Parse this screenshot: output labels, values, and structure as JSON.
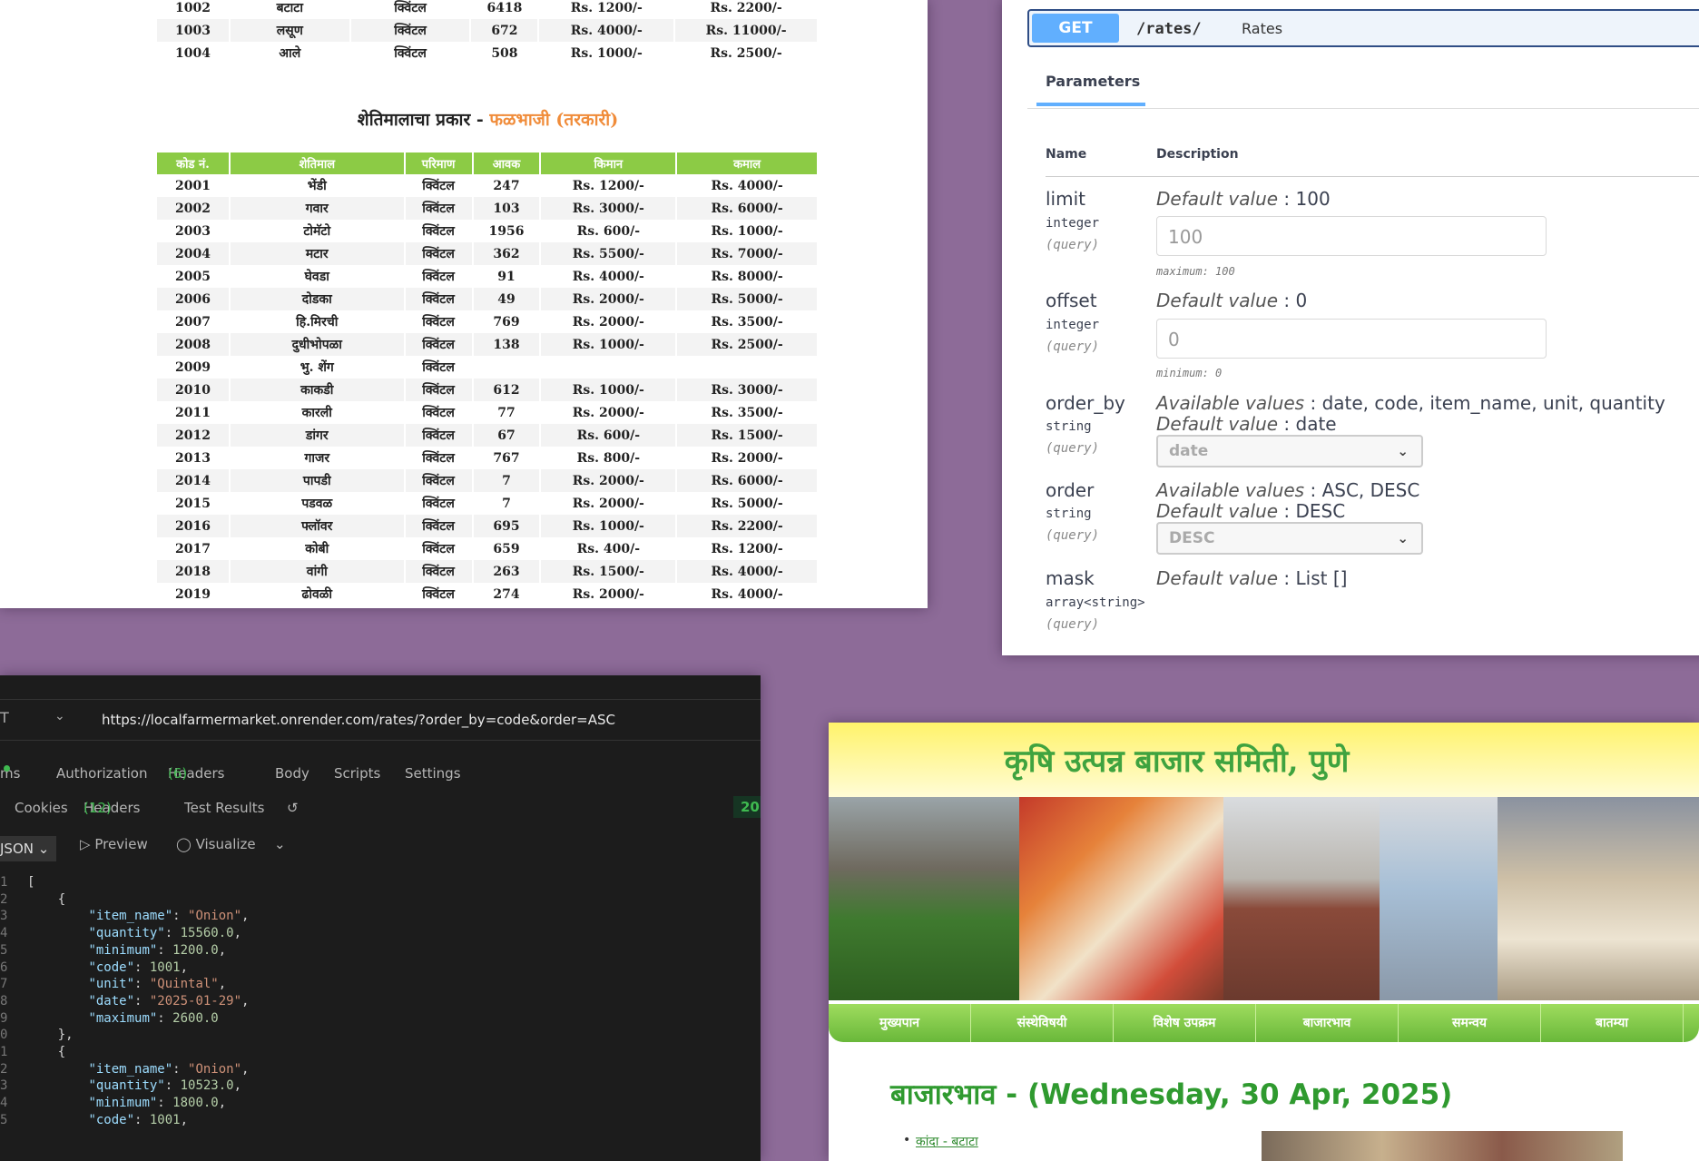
{
  "rates_sheet": {
    "top_rows": [
      [
        "1002",
        "बटाटा",
        "क्विंटल",
        "6418",
        "Rs. 1200/-",
        "Rs. 2200/-"
      ],
      [
        "1003",
        "लसूण",
        "क्विंटल",
        "672",
        "Rs. 4000/-",
        "Rs. 11000/-"
      ],
      [
        "1004",
        "आले",
        "क्विंटल",
        "508",
        "Rs. 1000/-",
        "Rs. 2500/-"
      ]
    ],
    "category_heading": "शेतिमालाचा प्रकार -",
    "category_name": "फळभाजी (तरकारी)",
    "columns": [
      "कोड नं.",
      "शेतिमाल",
      "परिमाण",
      "आवक",
      "किमान",
      "कमाल"
    ],
    "rows": [
      [
        "2001",
        "भेंडी",
        "क्विंटल",
        "247",
        "Rs. 1200/-",
        "Rs. 4000/-"
      ],
      [
        "2002",
        "गवार",
        "क्विंटल",
        "103",
        "Rs. 3000/-",
        "Rs. 6000/-"
      ],
      [
        "2003",
        "टोमॅटो",
        "क्विंटल",
        "1956",
        "Rs. 600/-",
        "Rs. 1000/-"
      ],
      [
        "2004",
        "मटार",
        "क्विंटल",
        "362",
        "Rs. 5500/-",
        "Rs. 7000/-"
      ],
      [
        "2005",
        "घेवडा",
        "क्विंटल",
        "91",
        "Rs. 4000/-",
        "Rs. 8000/-"
      ],
      [
        "2006",
        "दोडका",
        "क्विंटल",
        "49",
        "Rs. 2000/-",
        "Rs. 5000/-"
      ],
      [
        "2007",
        "हि.मिरची",
        "क्विंटल",
        "769",
        "Rs. 2000/-",
        "Rs. 3500/-"
      ],
      [
        "2008",
        "दुधीभोपळा",
        "क्विंटल",
        "138",
        "Rs. 1000/-",
        "Rs. 2500/-"
      ],
      [
        "2009",
        "भु. शेंग",
        "क्विंटल",
        "",
        "",
        ""
      ],
      [
        "2010",
        "काकडी",
        "क्विंटल",
        "612",
        "Rs. 1000/-",
        "Rs. 3000/-"
      ],
      [
        "2011",
        "कारली",
        "क्विंटल",
        "77",
        "Rs. 2000/-",
        "Rs. 3500/-"
      ],
      [
        "2012",
        "डांगर",
        "क्विंटल",
        "67",
        "Rs. 600/-",
        "Rs. 1500/-"
      ],
      [
        "2013",
        "गाजर",
        "क्विंटल",
        "767",
        "Rs. 800/-",
        "Rs. 2000/-"
      ],
      [
        "2014",
        "पापडी",
        "क्विंटल",
        "7",
        "Rs. 2000/-",
        "Rs. 6000/-"
      ],
      [
        "2015",
        "पडवळ",
        "क्विंटल",
        "7",
        "Rs. 2000/-",
        "Rs. 5000/-"
      ],
      [
        "2016",
        "फ्लॉवर",
        "क्विंटल",
        "695",
        "Rs. 1000/-",
        "Rs. 2200/-"
      ],
      [
        "2017",
        "कोबी",
        "क्विंटल",
        "659",
        "Rs. 400/-",
        "Rs. 1200/-"
      ],
      [
        "2018",
        "वांगी",
        "क्विंटल",
        "263",
        "Rs. 1500/-",
        "Rs. 4000/-"
      ],
      [
        "2019",
        "ढोवळी",
        "क्विंटल",
        "274",
        "Rs. 2000/-",
        "Rs. 4000/-"
      ]
    ]
  },
  "swagger": {
    "method": "GET",
    "path": "/rates/",
    "summary": "Rates",
    "tab": "Parameters",
    "col_name": "Name",
    "col_description": "Description",
    "params": {
      "limit": {
        "name": "limit",
        "type": "integer",
        "in": "(query)",
        "default_label": "Default value",
        "default": "100",
        "input": "100",
        "note": "maximum: 100"
      },
      "offset": {
        "name": "offset",
        "type": "integer",
        "in": "(query)",
        "default_label": "Default value",
        "default": "0",
        "input": "0",
        "note": "minimum: 0"
      },
      "order_by": {
        "name": "order_by",
        "type": "string",
        "in": "(query)",
        "avail_label": "Available values",
        "available": "date, code, item_name, unit, quantity",
        "default_label": "Default value",
        "default": "date",
        "selected": "date"
      },
      "order": {
        "name": "order",
        "type": "string",
        "in": "(query)",
        "avail_label": "Available values",
        "available": "ASC, DESC",
        "default_label": "Default value",
        "default": "DESC",
        "selected": "DESC"
      },
      "mask": {
        "name": "mask",
        "type": "array<string>",
        "in": "(query)",
        "default_label": "Default value",
        "default": "List []"
      }
    }
  },
  "postman": {
    "method_fragment": "T",
    "url": "https://localfarmermarket.onrender.com/rates/?order_by=code&order=ASC",
    "request_tabs": {
      "params": "ms",
      "authorization": "Authorization",
      "headers": "Headers",
      "headers_count": "(6)",
      "body": "Body",
      "scripts": "Scripts",
      "settings": "Settings"
    },
    "response_tabs": {
      "cookies": "Cookies",
      "headers": "Headers",
      "headers_count": "(12)",
      "test_results": "Test Results"
    },
    "status": "20",
    "format": "JSON",
    "preview": "Preview",
    "visualize": "Visualize",
    "json_lines": [
      {
        "ln": "1",
        "txt": "["
      },
      {
        "ln": "2",
        "txt": "    {"
      },
      {
        "ln": "3",
        "key": "\"item_name\"",
        "val": "\"Onion\"",
        "kind": "s"
      },
      {
        "ln": "4",
        "key": "\"quantity\"",
        "val": "15560.0",
        "kind": "n"
      },
      {
        "ln": "5",
        "key": "\"minimum\"",
        "val": "1200.0",
        "kind": "n"
      },
      {
        "ln": "6",
        "key": "\"code\"",
        "val": "1001",
        "kind": "n"
      },
      {
        "ln": "7",
        "key": "\"unit\"",
        "val": "\"Quintal\"",
        "kind": "s"
      },
      {
        "ln": "8",
        "key": "\"date\"",
        "val": "\"2025-01-29\"",
        "kind": "s"
      },
      {
        "ln": "9",
        "key": "\"maximum\"",
        "val": "2600.0",
        "kind": "n",
        "last": true
      },
      {
        "ln": "0",
        "txt": "    },"
      },
      {
        "ln": "1",
        "txt": "    {"
      },
      {
        "ln": "2",
        "key": "\"item_name\"",
        "val": "\"Onion\"",
        "kind": "s"
      },
      {
        "ln": "3",
        "key": "\"quantity\"",
        "val": "10523.0",
        "kind": "n"
      },
      {
        "ln": "4",
        "key": "\"minimum\"",
        "val": "1800.0",
        "kind": "n"
      },
      {
        "ln": "5",
        "key": "\"code\"",
        "val": "1001",
        "kind": "n"
      }
    ]
  },
  "market_site": {
    "title": "कृषि उत्पन्न बाजार समिती, पुणे",
    "nav": [
      "मुख्यपान",
      "संस्थेविषयी",
      "विशेष उपक्रम",
      "बाजारभाव",
      "समन्वय",
      "बातम्या"
    ],
    "heading": "बाजारभाव - (Wednesday, 30 Apr, 2025)",
    "link": "कांदा - बटाटा"
  },
  "colors": {
    "background": "#8d6b98",
    "table_header": "#8ccb45",
    "category_orange": "#f08c3a",
    "swagger_get": "#61affe",
    "site_green": "#3fa33f"
  }
}
